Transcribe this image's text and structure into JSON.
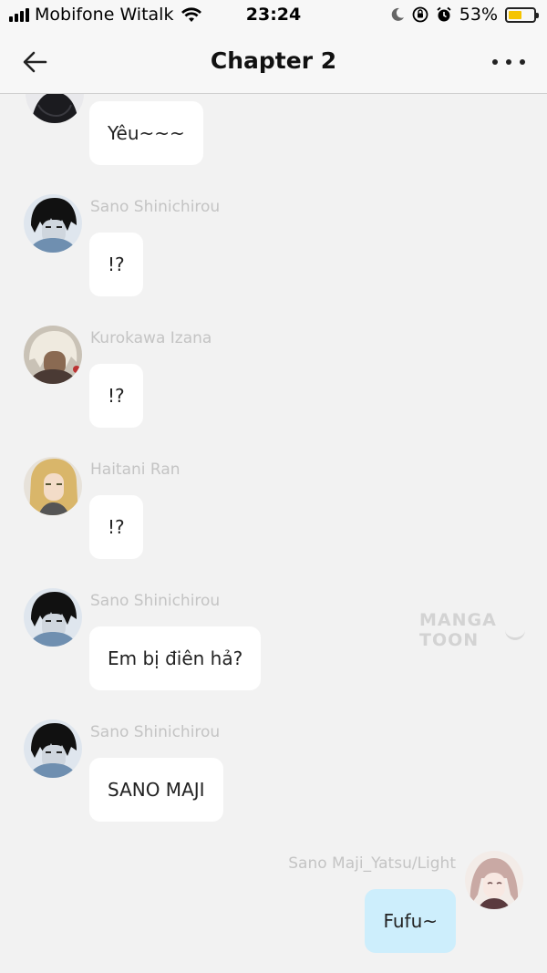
{
  "status_bar": {
    "carrier": "Mobifone Witalk",
    "time": "23:24",
    "battery_percent": "53%",
    "battery_level": 0.53,
    "battery_color": "#f5c400"
  },
  "header": {
    "title": "Chapter 2",
    "back_icon": "arrow-left-icon",
    "more_icon": "more-horizontal-icon"
  },
  "messages": [
    {
      "sender": "",
      "text": "Yêu~~~",
      "side": "left"
    },
    {
      "sender": "Sano Shinichirou",
      "text": "!?",
      "side": "left"
    },
    {
      "sender": "Kurokawa Izana",
      "text": "!?",
      "side": "left"
    },
    {
      "sender": "Haitani Ran",
      "text": "!?",
      "side": "left"
    },
    {
      "sender": "Sano Shinichirou",
      "text": "Em bị điên hả?",
      "side": "left"
    },
    {
      "sender": "Sano Shinichirou",
      "text": "SANO MAJI",
      "side": "left"
    },
    {
      "sender": "Sano Maji_Yatsu/Light",
      "text": "Fufu~",
      "side": "right"
    }
  ],
  "watermark": "MANGA TOON",
  "colors": {
    "background": "#f2f2f2",
    "bubble_left": "#ffffff",
    "bubble_right": "#cdeefc",
    "sender_name": "#c4c4c4"
  }
}
